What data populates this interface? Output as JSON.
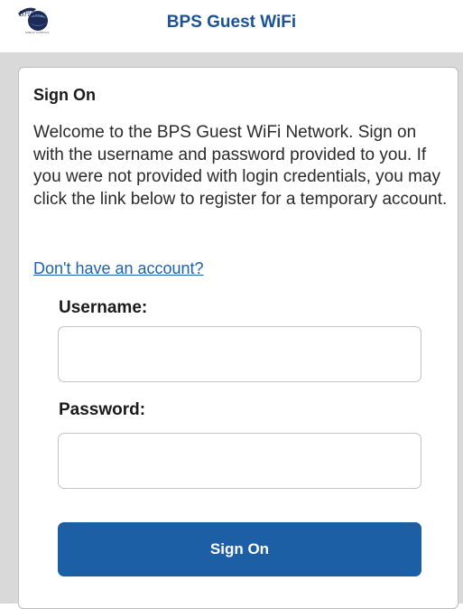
{
  "header": {
    "title": "BPS Guest WiFi",
    "logo_icon": "school-globe-logo-icon"
  },
  "signon": {
    "title": "Sign On",
    "intro": "Welcome to the BPS Guest WiFi Network. Sign on with the username and password provided to you.  If you were not provided with login credentials, you may click the link below to register for a temporary account.",
    "register_link": "Don't have an account?",
    "username_label": "Username:",
    "username_value": "",
    "password_label": "Password:",
    "password_value": "",
    "submit_label": "Sign On"
  },
  "colors": {
    "brand": "#1b5294",
    "button": "#1d5fa5",
    "link": "#1a62b3",
    "band": "#d9d9d9"
  }
}
